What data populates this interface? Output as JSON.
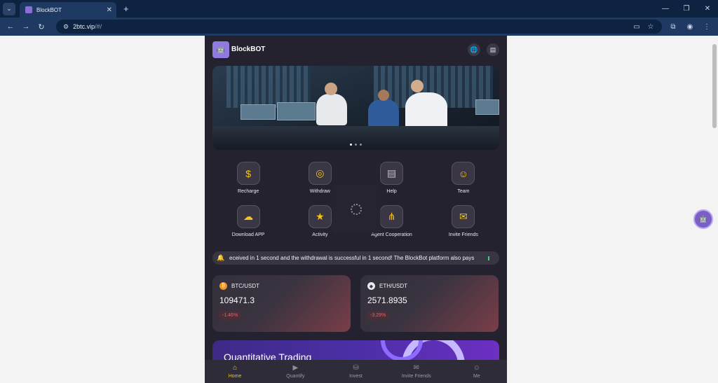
{
  "browser": {
    "tab_title": "BlockBOT",
    "url_host": "2btc.vip",
    "url_path": "/#/"
  },
  "header": {
    "brand": "BlockBOT"
  },
  "menu": [
    {
      "label": "Recharge",
      "icon": "recharge-icon",
      "glyph": "$"
    },
    {
      "label": "Withdraw",
      "icon": "withdraw-icon",
      "glyph": "◎"
    },
    {
      "label": "Help",
      "icon": "help-icon",
      "glyph": "▤"
    },
    {
      "label": "Team",
      "icon": "team-icon",
      "glyph": "☺"
    },
    {
      "label": "Download APP",
      "icon": "download-icon",
      "glyph": "☁"
    },
    {
      "label": "Activity",
      "icon": "activity-icon",
      "glyph": "★"
    },
    {
      "label": "Agent Cooperation",
      "icon": "agent-icon",
      "glyph": "⋔"
    },
    {
      "label": "Invite Friends",
      "icon": "invite-icon",
      "glyph": "✉"
    }
  ],
  "notice": {
    "text": "eceived in 1 second and the withdrawal is successful in 1 second! The BlockBot platform also pays"
  },
  "markets": [
    {
      "pair": "BTC/USDT",
      "price": "109471.3",
      "change": "-1.46%",
      "coin_color": "#f7931a",
      "coin_glyph": "₿"
    },
    {
      "pair": "ETH/USDT",
      "price": "2571.8935",
      "change": "-3.29%",
      "coin_color": "#e8e8ef",
      "coin_glyph": "◆"
    }
  ],
  "promo": {
    "title": "Quantitative Trading"
  },
  "nav": [
    {
      "label": "Home",
      "icon": "home-icon",
      "glyph": "⌂",
      "active": true
    },
    {
      "label": "Quantify",
      "icon": "quantify-icon",
      "glyph": "▶",
      "active": false
    },
    {
      "label": "Invest",
      "icon": "invest-icon",
      "glyph": "⛁",
      "active": false
    },
    {
      "label": "Invite Friends",
      "icon": "invite-friends-icon",
      "glyph": "✉",
      "active": false
    },
    {
      "label": "Me",
      "icon": "me-icon",
      "glyph": "☺",
      "active": false
    }
  ],
  "colors": {
    "accent": "#f5c518",
    "negative": "#ff5a5a",
    "app_bg": "#25222f"
  }
}
